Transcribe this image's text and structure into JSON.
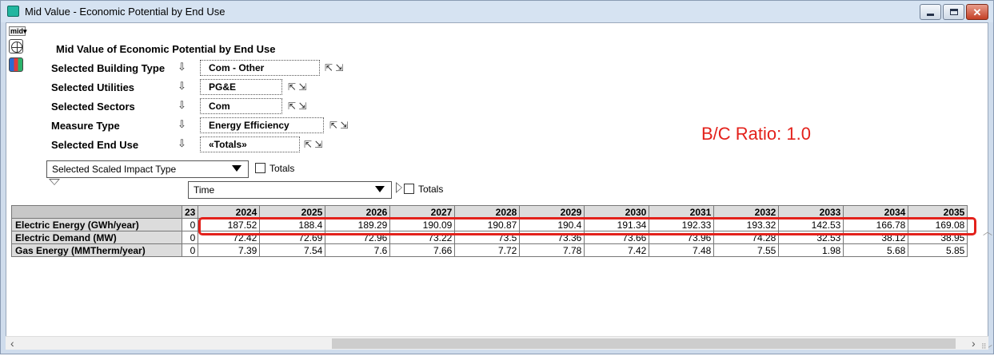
{
  "window": {
    "title": "Mid Value - Economic Potential by End Use",
    "buttons": {
      "minimize_icon": "minimize-icon",
      "maximize_icon": "maximize-icon",
      "close_icon": "close-icon"
    }
  },
  "toolbar": {
    "mid_label": "mid▾",
    "grid_icon": "table-icon",
    "graph_icon": "graph-icon"
  },
  "heading": "Mid Value of Economic Potential by End Use",
  "params": [
    {
      "label": "Selected Building Type",
      "value": "Com - Other"
    },
    {
      "label": "Selected Utilities",
      "value": "PG&E"
    },
    {
      "label": "Selected Sectors",
      "value": "Com"
    },
    {
      "label": "Measure Type",
      "value": "Energy Efficiency"
    },
    {
      "label": "Selected End Use",
      "value": "«Totals»"
    }
  ],
  "icons": {
    "down_arrow": "⇩",
    "pair": "⇱ ⇲"
  },
  "annotation": {
    "bc_ratio": "B/C Ratio: 1.0"
  },
  "row_dimension": {
    "value": "Selected Scaled Impact Type",
    "totals_label": "Totals"
  },
  "column_dimension": {
    "value": "Time",
    "totals_label": "Totals"
  },
  "table": {
    "partial_header": "23",
    "years": [
      "2024",
      "2025",
      "2026",
      "2027",
      "2028",
      "2029",
      "2030",
      "2031",
      "2032",
      "2033",
      "2034",
      "2035"
    ],
    "rows": [
      {
        "label": "Electric Energy (GWh/year)",
        "partial": "0",
        "values": [
          "187.52",
          "188.4",
          "189.29",
          "190.09",
          "190.87",
          "190.4",
          "191.34",
          "192.33",
          "193.32",
          "142.53",
          "166.78",
          "169.08"
        ]
      },
      {
        "label": "Electric Demand (MW)",
        "partial": "0",
        "values": [
          "72.42",
          "72.69",
          "72.96",
          "73.22",
          "73.5",
          "73.36",
          "73.66",
          "73.96",
          "74.28",
          "32.53",
          "38.12",
          "38.95"
        ]
      },
      {
        "label": "Gas Energy (MMTherm/year)",
        "partial": "0",
        "values": [
          "7.39",
          "7.54",
          "7.6",
          "7.66",
          "7.72",
          "7.78",
          "7.42",
          "7.48",
          "7.55",
          "1.98",
          "5.68",
          "5.85"
        ]
      }
    ]
  },
  "colors": {
    "highlight": "#e3211b",
    "annotation_text": "#e3211b"
  }
}
